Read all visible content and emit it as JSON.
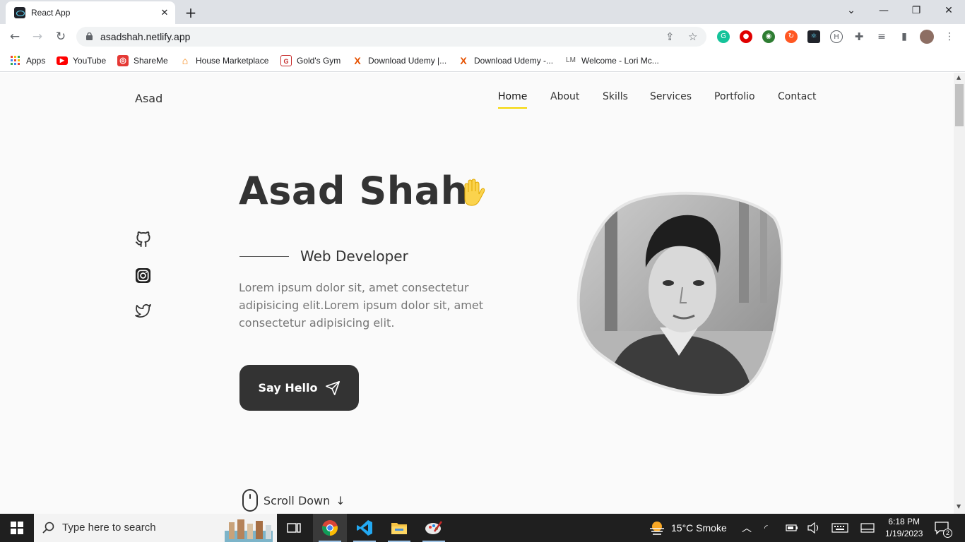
{
  "browser": {
    "tab_title": "React App",
    "url": "asadshah.netlify.app"
  },
  "bookmarks": [
    {
      "label": "Apps",
      "icon": "apps-grid-icon",
      "color": "#ea4335"
    },
    {
      "label": "YouTube",
      "icon": "youtube-icon",
      "color": "#ff0000"
    },
    {
      "label": "ShareMe",
      "icon": "shareme-icon",
      "color": "#e53935"
    },
    {
      "label": "House Marketplace",
      "icon": "house-icon",
      "color": "#f57c00"
    },
    {
      "label": "Gold's Gym",
      "icon": "golds-gym-icon",
      "color": "#c62828"
    },
    {
      "label": "Download Udemy |...",
      "icon": "udemy-x-icon",
      "color": "#e65100"
    },
    {
      "label": "Download Udemy -...",
      "icon": "udemy-x-icon",
      "color": "#e65100"
    },
    {
      "label": "Welcome - Lori Mc...",
      "icon": "lm-icon",
      "color": "#555555"
    }
  ],
  "site": {
    "logo": "Asad",
    "nav": [
      "Home",
      "About",
      "Skills",
      "Services",
      "Portfolio",
      "Contact"
    ],
    "active_nav": "Home",
    "accent": "#f5d600",
    "name": "Asad Shah",
    "subtitle": "Web Developer",
    "description": "Lorem ipsum dolor sit, amet consectetur adipisicing elit.Lorem ipsum dolor sit, amet consectetur adipisicing elit.",
    "button_label": "Say Hello",
    "scroll_label": "Scroll Down",
    "social_icons": [
      "github-icon",
      "instagram-icon",
      "twitter-icon"
    ]
  },
  "taskbar": {
    "search_placeholder": "Type here to search",
    "weather": "15°C  Smoke",
    "time": "6:18 PM",
    "date": "1/19/2023",
    "notifications": "2"
  }
}
